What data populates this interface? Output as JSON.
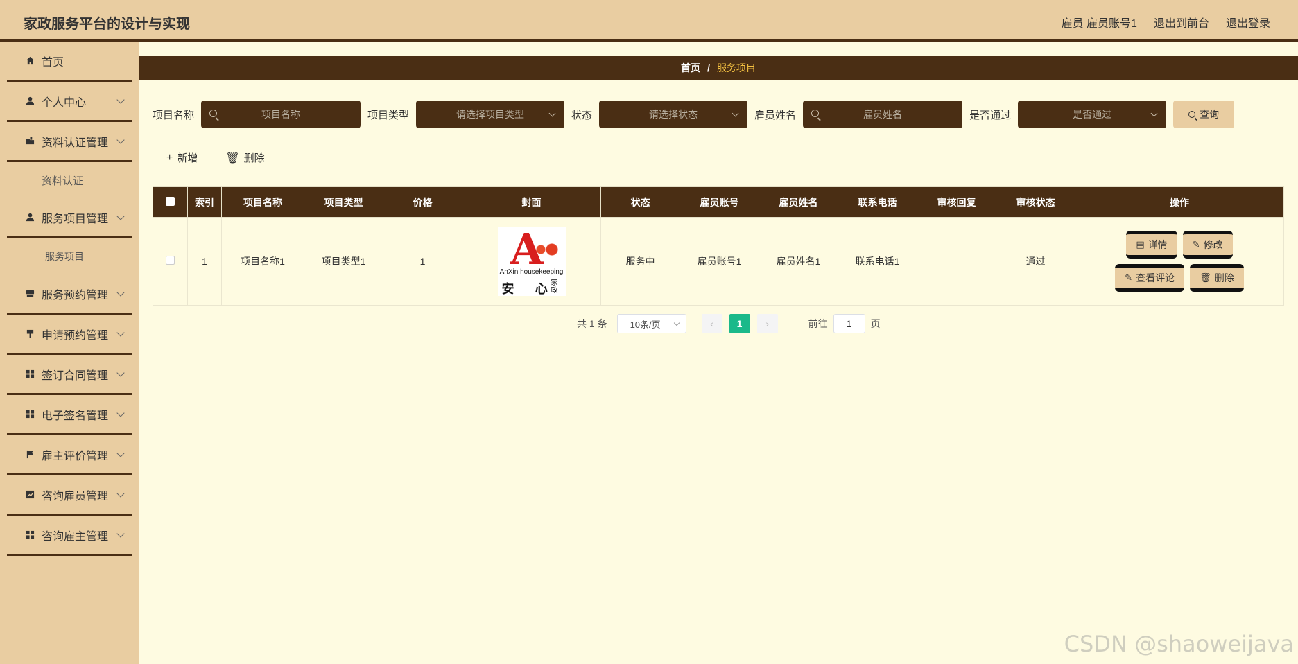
{
  "header": {
    "title": "家政服务平台的设计与实现",
    "user": "雇员 雇员账号1",
    "front": "退出到前台",
    "logout": "退出登录"
  },
  "sidebar": {
    "items": [
      {
        "label": "首页",
        "icon": "home-icon"
      },
      {
        "label": "个人中心",
        "icon": "user-icon"
      },
      {
        "label": "资料认证管理",
        "icon": "folder-icon"
      },
      {
        "label": "资料认证",
        "sub": true
      },
      {
        "label": "服务项目管理",
        "icon": "user-icon"
      },
      {
        "label": "服务项目",
        "sub": true
      },
      {
        "label": "服务预约管理",
        "icon": "box-icon"
      },
      {
        "label": "申请预约管理",
        "icon": "pin-icon"
      },
      {
        "label": "签订合同管理",
        "icon": "grid-icon"
      },
      {
        "label": "电子签名管理",
        "icon": "grid-icon"
      },
      {
        "label": "雇主评价管理",
        "icon": "flag-icon"
      },
      {
        "label": "咨询雇员管理",
        "icon": "chart-icon"
      },
      {
        "label": "咨询雇主管理",
        "icon": "grid-icon"
      }
    ]
  },
  "breadcrumb": {
    "home": "首页",
    "sep": "/",
    "current": "服务项目"
  },
  "search": {
    "name_label": "项目名称",
    "name_placeholder": "项目名称",
    "type_label": "项目类型",
    "type_placeholder": "请选择项目类型",
    "status_label": "状态",
    "status_placeholder": "请选择状态",
    "emp_label": "雇员姓名",
    "emp_placeholder": "雇员姓名",
    "pass_label": "是否通过",
    "pass_placeholder": "是否通过",
    "query": "查询"
  },
  "actions": {
    "add": "新增",
    "delete": "删除"
  },
  "table": {
    "headers": [
      "索引",
      "项目名称",
      "项目类型",
      "价格",
      "封面",
      "状态",
      "雇员账号",
      "雇员姓名",
      "联系电话",
      "审核回复",
      "审核状态",
      "操作"
    ],
    "rows": [
      {
        "index": "1",
        "name": "项目名称1",
        "type": "项目类型1",
        "price": "1",
        "status": "服务中",
        "account": "雇员账号1",
        "emp_name": "雇员姓名1",
        "phone": "联系电话1",
        "reply": "",
        "audit": "通过"
      }
    ],
    "cover": {
      "letter": "A",
      "en": "AnXin housekeeping",
      "cn": "安 心",
      "cn2": "家政"
    },
    "ops": {
      "detail": "详情",
      "edit": "修改",
      "comments": "查看评论",
      "delete": "删除"
    }
  },
  "pager": {
    "total": "共 1 条",
    "size": "10条/页",
    "page": "1",
    "goto": "前往",
    "jump": "1",
    "unit": "页"
  },
  "watermark": "CSDN @shaoweijava",
  "colors": {
    "header_bg": "#e9cda1",
    "dark": "#4a2e14",
    "main_bg": "#fefbe1",
    "accent": "#1bb98a"
  }
}
